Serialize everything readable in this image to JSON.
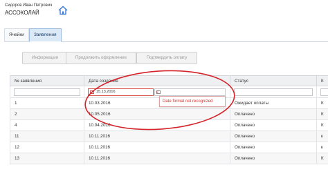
{
  "header": {
    "user_name": "Сидоров Иван Петрович",
    "org_name": "АССОКОЛАЙ"
  },
  "tabs": [
    {
      "label": "Ячейки"
    },
    {
      "label": "Заявления"
    }
  ],
  "toolbar": {
    "info_label": "Информация",
    "continue_label": "Продолжить оформление",
    "confirm_label": "Подтвердить оплату"
  },
  "table": {
    "columns": [
      "№ заявления",
      "Дата создания",
      "Статус",
      "К"
    ],
    "filter": {
      "date_from": "15.13.2016",
      "date_error": "Date format not recognized"
    },
    "rows": [
      [
        "1",
        "10.03.2016",
        "Ожидает оплаты",
        "К"
      ],
      [
        "2",
        "10.05.2016",
        "Оплачено",
        "К"
      ],
      [
        "4",
        "10.04.2016",
        "Оплачено",
        "К"
      ],
      [
        "11",
        "10.11.2016",
        "Оплачено",
        "к"
      ],
      [
        "12",
        "10.11.2016",
        "Оплачено",
        "к"
      ],
      [
        "13",
        "10.11.2016",
        "Оплачено",
        "К"
      ]
    ]
  },
  "colors": {
    "error": "#d0322e",
    "annotation": "#d4232a",
    "tab_active": "#dbe8f6"
  }
}
